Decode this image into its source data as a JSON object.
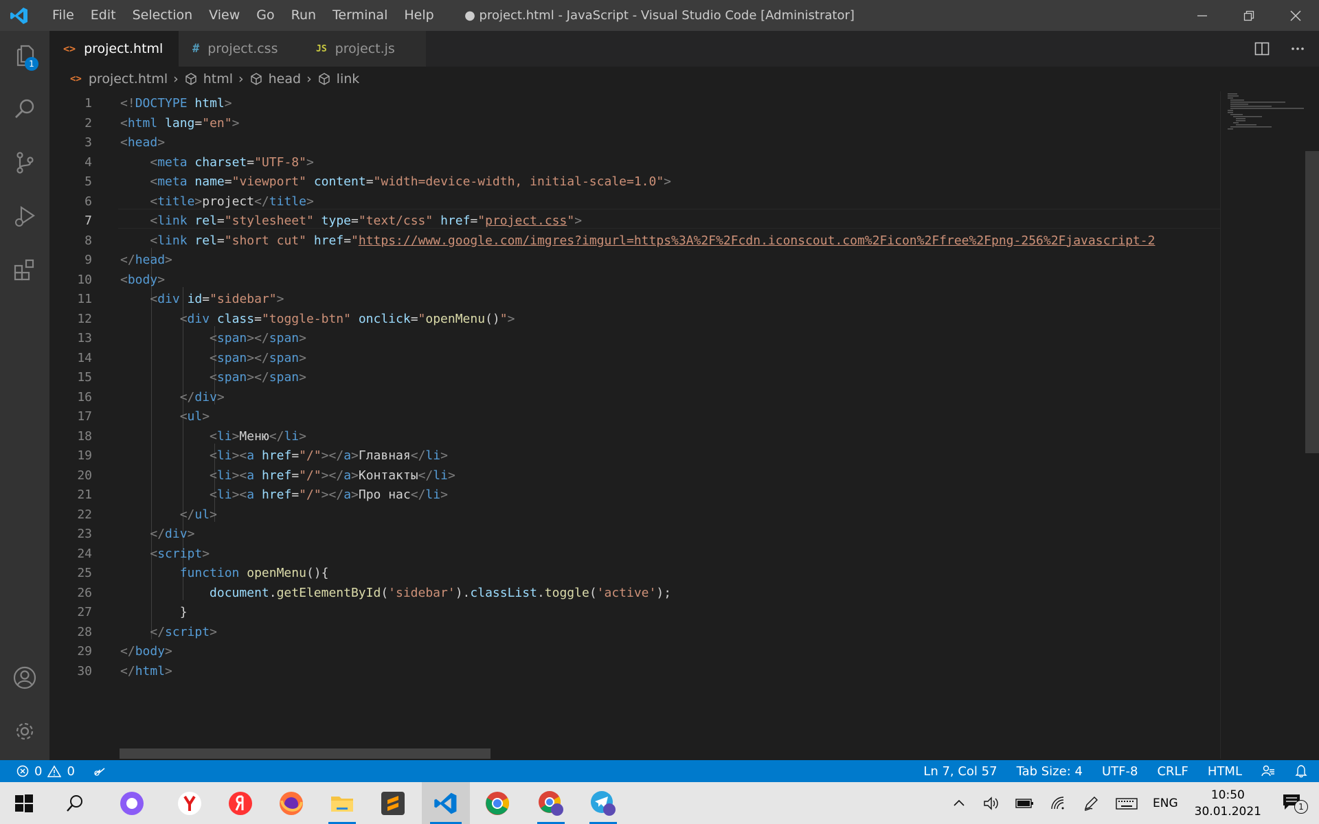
{
  "window": {
    "title": "● project.html - JavaScript - Visual Studio Code [Administrator]"
  },
  "menu": [
    "File",
    "Edit",
    "Selection",
    "View",
    "Go",
    "Run",
    "Terminal",
    "Help"
  ],
  "activity": {
    "explorer_badge": "1"
  },
  "tabs": [
    {
      "label": "project.html",
      "icon": "<>",
      "icon_color": "#e37933",
      "modified": true,
      "active": true
    },
    {
      "label": "project.css",
      "icon": "#",
      "icon_color": "#519aba",
      "active": false
    },
    {
      "label": "project.js",
      "icon": "JS",
      "icon_color": "#cbcb41",
      "active": false
    }
  ],
  "breadcrumb": [
    "project.html",
    "html",
    "head",
    "link"
  ],
  "editor": {
    "current_line": 7,
    "line_numbers": [
      "1",
      "2",
      "3",
      "4",
      "5",
      "6",
      "7",
      "8",
      "9",
      "10",
      "11",
      "12",
      "13",
      "14",
      "15",
      "16",
      "17",
      "18",
      "19",
      "20",
      "21",
      "22",
      "23",
      "24",
      "25",
      "26",
      "27",
      "28",
      "29",
      "30"
    ],
    "lines": [
      [
        [
          "p",
          "<!"
        ],
        [
          "t",
          "DOCTYPE"
        ],
        [
          "x",
          " "
        ],
        [
          "a",
          "html"
        ],
        [
          "p",
          ">"
        ]
      ],
      [
        [
          "p",
          "<"
        ],
        [
          "t",
          "html"
        ],
        [
          "x",
          " "
        ],
        [
          "a",
          "lang"
        ],
        [
          "x",
          "="
        ],
        [
          "s",
          "\"en\""
        ],
        [
          "p",
          ">"
        ]
      ],
      [
        [
          "p",
          "<"
        ],
        [
          "t",
          "head"
        ],
        [
          "p",
          ">"
        ]
      ],
      [
        [
          "x",
          "    "
        ],
        [
          "p",
          "<"
        ],
        [
          "t",
          "meta"
        ],
        [
          "x",
          " "
        ],
        [
          "a",
          "charset"
        ],
        [
          "x",
          "="
        ],
        [
          "s",
          "\"UTF-8\""
        ],
        [
          "p",
          ">"
        ]
      ],
      [
        [
          "x",
          "    "
        ],
        [
          "p",
          "<"
        ],
        [
          "t",
          "meta"
        ],
        [
          "x",
          " "
        ],
        [
          "a",
          "name"
        ],
        [
          "x",
          "="
        ],
        [
          "s",
          "\"viewport\""
        ],
        [
          "x",
          " "
        ],
        [
          "a",
          "content"
        ],
        [
          "x",
          "="
        ],
        [
          "s",
          "\"width=device-width, initial-scale=1.0\""
        ],
        [
          "p",
          ">"
        ]
      ],
      [
        [
          "x",
          "    "
        ],
        [
          "p",
          "<"
        ],
        [
          "t",
          "title"
        ],
        [
          "p",
          ">"
        ],
        [
          "x",
          "project"
        ],
        [
          "p",
          "</"
        ],
        [
          "t",
          "title"
        ],
        [
          "p",
          ">"
        ]
      ],
      [
        [
          "x",
          "    "
        ],
        [
          "p",
          "<"
        ],
        [
          "t",
          "link"
        ],
        [
          "x",
          " "
        ],
        [
          "a",
          "rel"
        ],
        [
          "x",
          "="
        ],
        [
          "s",
          "\"stylesheet\""
        ],
        [
          "x",
          " "
        ],
        [
          "a",
          "type"
        ],
        [
          "x",
          "="
        ],
        [
          "s",
          "\"text/css\""
        ],
        [
          "x",
          " "
        ],
        [
          "a",
          "href"
        ],
        [
          "x",
          "="
        ],
        [
          "s",
          "\""
        ],
        [
          "su",
          "project.css"
        ],
        [
          "s",
          "\""
        ],
        [
          "p",
          ">"
        ]
      ],
      [
        [
          "x",
          "    "
        ],
        [
          "p",
          "<"
        ],
        [
          "t",
          "link"
        ],
        [
          "x",
          " "
        ],
        [
          "a",
          "rel"
        ],
        [
          "x",
          "="
        ],
        [
          "s",
          "\"short cut\""
        ],
        [
          "x",
          " "
        ],
        [
          "a",
          "href"
        ],
        [
          "x",
          "="
        ],
        [
          "s",
          "\""
        ],
        [
          "su",
          "https://www.google.com/imgres?imgurl=https%3A%2F%2Fcdn.iconscout.com%2Ficon%2Ffree%2Fpng-256%2Fjavascript-2"
        ]
      ],
      [
        [
          "p",
          "</"
        ],
        [
          "t",
          "head"
        ],
        [
          "p",
          ">"
        ]
      ],
      [
        [
          "p",
          "<"
        ],
        [
          "t",
          "body"
        ],
        [
          "p",
          ">"
        ]
      ],
      [
        [
          "x",
          "    "
        ],
        [
          "p",
          "<"
        ],
        [
          "t",
          "div"
        ],
        [
          "x",
          " "
        ],
        [
          "a",
          "id"
        ],
        [
          "x",
          "="
        ],
        [
          "s",
          "\"sidebar\""
        ],
        [
          "p",
          ">"
        ]
      ],
      [
        [
          "x",
          "        "
        ],
        [
          "p",
          "<"
        ],
        [
          "t",
          "div"
        ],
        [
          "x",
          " "
        ],
        [
          "a",
          "class"
        ],
        [
          "x",
          "="
        ],
        [
          "s",
          "\"toggle-btn\""
        ],
        [
          "x",
          " "
        ],
        [
          "a",
          "onclick"
        ],
        [
          "x",
          "="
        ],
        [
          "s",
          "\""
        ],
        [
          "f",
          "openMenu"
        ],
        [
          "x",
          "()"
        ],
        [
          "s",
          "\""
        ],
        [
          "p",
          ">"
        ]
      ],
      [
        [
          "x",
          "            "
        ],
        [
          "p",
          "<"
        ],
        [
          "t",
          "span"
        ],
        [
          "p",
          "></"
        ],
        [
          "t",
          "span"
        ],
        [
          "p",
          ">"
        ]
      ],
      [
        [
          "x",
          "            "
        ],
        [
          "p",
          "<"
        ],
        [
          "t",
          "span"
        ],
        [
          "p",
          "></"
        ],
        [
          "t",
          "span"
        ],
        [
          "p",
          ">"
        ]
      ],
      [
        [
          "x",
          "            "
        ],
        [
          "p",
          "<"
        ],
        [
          "t",
          "span"
        ],
        [
          "p",
          "></"
        ],
        [
          "t",
          "span"
        ],
        [
          "p",
          ">"
        ]
      ],
      [
        [
          "x",
          "        "
        ],
        [
          "p",
          "</"
        ],
        [
          "t",
          "div"
        ],
        [
          "p",
          ">"
        ]
      ],
      [
        [
          "x",
          "        "
        ],
        [
          "p",
          "<"
        ],
        [
          "t",
          "ul"
        ],
        [
          "p",
          ">"
        ]
      ],
      [
        [
          "x",
          "            "
        ],
        [
          "p",
          "<"
        ],
        [
          "t",
          "li"
        ],
        [
          "p",
          ">"
        ],
        [
          "x",
          "Меню"
        ],
        [
          "p",
          "</"
        ],
        [
          "t",
          "li"
        ],
        [
          "p",
          ">"
        ]
      ],
      [
        [
          "x",
          "            "
        ],
        [
          "p",
          "<"
        ],
        [
          "t",
          "li"
        ],
        [
          "p",
          "><"
        ],
        [
          "t",
          "a"
        ],
        [
          "x",
          " "
        ],
        [
          "a",
          "href"
        ],
        [
          "x",
          "="
        ],
        [
          "s",
          "\"/\""
        ],
        [
          "p",
          "></"
        ],
        [
          "t",
          "a"
        ],
        [
          "p",
          ">"
        ],
        [
          "x",
          "Главная"
        ],
        [
          "p",
          "</"
        ],
        [
          "t",
          "li"
        ],
        [
          "p",
          ">"
        ]
      ],
      [
        [
          "x",
          "            "
        ],
        [
          "p",
          "<"
        ],
        [
          "t",
          "li"
        ],
        [
          "p",
          "><"
        ],
        [
          "t",
          "a"
        ],
        [
          "x",
          " "
        ],
        [
          "a",
          "href"
        ],
        [
          "x",
          "="
        ],
        [
          "s",
          "\"/\""
        ],
        [
          "p",
          "></"
        ],
        [
          "t",
          "a"
        ],
        [
          "p",
          ">"
        ],
        [
          "x",
          "Контакты"
        ],
        [
          "p",
          "</"
        ],
        [
          "t",
          "li"
        ],
        [
          "p",
          ">"
        ]
      ],
      [
        [
          "x",
          "            "
        ],
        [
          "p",
          "<"
        ],
        [
          "t",
          "li"
        ],
        [
          "p",
          "><"
        ],
        [
          "t",
          "a"
        ],
        [
          "x",
          " "
        ],
        [
          "a",
          "href"
        ],
        [
          "x",
          "="
        ],
        [
          "s",
          "\"/\""
        ],
        [
          "p",
          "></"
        ],
        [
          "t",
          "a"
        ],
        [
          "p",
          ">"
        ],
        [
          "x",
          "Про нас"
        ],
        [
          "p",
          "</"
        ],
        [
          "t",
          "li"
        ],
        [
          "p",
          ">"
        ]
      ],
      [
        [
          "x",
          "        "
        ],
        [
          "p",
          "</"
        ],
        [
          "t",
          "ul"
        ],
        [
          "p",
          ">"
        ]
      ],
      [
        [
          "x",
          "    "
        ],
        [
          "p",
          "</"
        ],
        [
          "t",
          "div"
        ],
        [
          "p",
          ">"
        ]
      ],
      [
        [
          "x",
          "    "
        ],
        [
          "p",
          "<"
        ],
        [
          "t",
          "script"
        ],
        [
          "p",
          ">"
        ]
      ],
      [
        [
          "x",
          "        "
        ],
        [
          "k",
          "function"
        ],
        [
          "x",
          " "
        ],
        [
          "f",
          "openMenu"
        ],
        [
          "x",
          "(){"
        ]
      ],
      [
        [
          "x",
          "            "
        ],
        [
          "a",
          "document"
        ],
        [
          "x",
          "."
        ],
        [
          "f",
          "getElementById"
        ],
        [
          "x",
          "("
        ],
        [
          "s",
          "'sidebar'"
        ],
        [
          "x",
          ")."
        ],
        [
          "a",
          "classList"
        ],
        [
          "x",
          "."
        ],
        [
          "f",
          "toggle"
        ],
        [
          "x",
          "("
        ],
        [
          "s",
          "'active'"
        ],
        [
          "x",
          ");"
        ]
      ],
      [
        [
          "x",
          "        }"
        ]
      ],
      [
        [
          "x",
          "    "
        ],
        [
          "p",
          "</"
        ],
        [
          "t",
          "script"
        ],
        [
          "p",
          ">"
        ]
      ],
      [
        [
          "p",
          "</"
        ],
        [
          "t",
          "body"
        ],
        [
          "p",
          ">"
        ]
      ],
      [
        [
          "p",
          "</"
        ],
        [
          "t",
          "html"
        ],
        [
          "p",
          ">"
        ]
      ]
    ]
  },
  "statusbar": {
    "errors": "0",
    "warnings": "0",
    "position": "Ln 7, Col 57",
    "tab_size": "Tab Size: 4",
    "encoding": "UTF-8",
    "eol": "CRLF",
    "language": "HTML"
  },
  "taskbar": {
    "language": "ENG",
    "time": "10:50",
    "date": "30.01.2021",
    "notification_count": "1"
  },
  "colors": {
    "accent": "#007acc",
    "titlebar": "#3c3c3c",
    "editor_bg": "#1e1e1e"
  }
}
